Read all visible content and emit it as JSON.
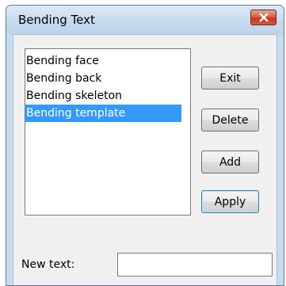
{
  "window": {
    "title": "Bending Text",
    "close_icon": "close-icon"
  },
  "list": {
    "items": [
      {
        "label": "Bending face",
        "selected": false
      },
      {
        "label": "Bending back",
        "selected": false
      },
      {
        "label": "Bending skeleton",
        "selected": false
      },
      {
        "label": "Bending template",
        "selected": true
      }
    ]
  },
  "buttons": {
    "exit": "Exit",
    "delete": "Delete",
    "add": "Add",
    "apply": "Apply"
  },
  "new_text": {
    "label": "New text:",
    "value": "",
    "placeholder": ""
  },
  "colors": {
    "selection": "#3399ff",
    "close_button": "#c23a21",
    "title_bar": "#c6daee"
  }
}
